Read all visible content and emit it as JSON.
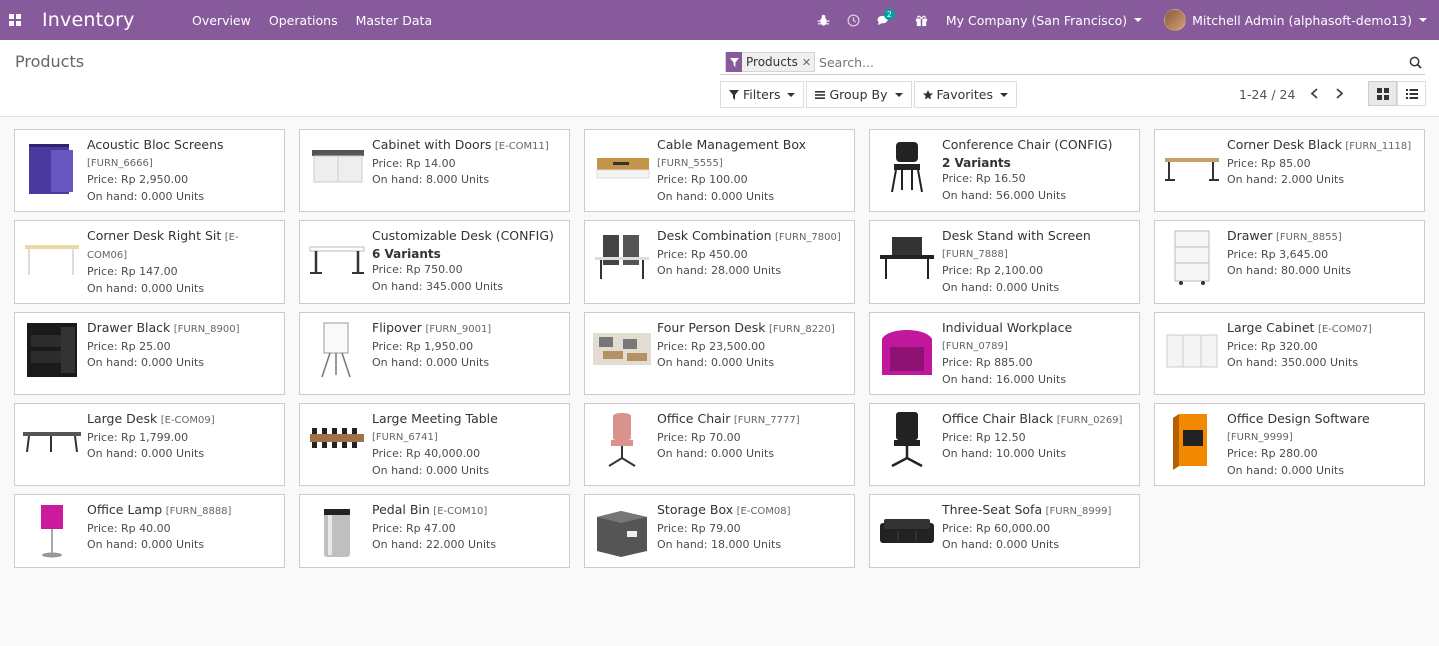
{
  "navbar": {
    "app_title": "Inventory",
    "menu": [
      "Overview",
      "Operations",
      "Master Data"
    ],
    "chat_badge": "2",
    "company": "My Company (San Francisco)",
    "user": "Mitchell Admin (alphasoft-demo13)",
    "color": "#875a9b"
  },
  "control": {
    "title": "Products",
    "facet": "Products",
    "search_placeholder": "Search...",
    "filters_label": "Filters",
    "groupby_label": "Group By",
    "favorites_label": "Favorites",
    "pager": "1-24 / 24"
  },
  "products": [
    {
      "name": "Acoustic Bloc Screens",
      "code": "[FURN_6666]",
      "price": "Price: Rp 2,950.00",
      "onhand": "On hand: 0.000 Units",
      "variants": "",
      "icon": "acoustic-screen-image"
    },
    {
      "name": "Cabinet with Doors",
      "code": "[E-COM11]",
      "price": "Price: Rp 14.00",
      "onhand": "On hand: 8.000 Units",
      "variants": "",
      "icon": "cabinet-image"
    },
    {
      "name": "Cable Management Box",
      "code": "[FURN_5555]",
      "price": "Price: Rp 100.00",
      "onhand": "On hand: 0.000 Units",
      "variants": "",
      "icon": "cable-box-image"
    },
    {
      "name": "Conference Chair (CONFIG)",
      "code": "",
      "price": "Price: Rp 16.50",
      "onhand": "On hand: 56.000 Units",
      "variants": "2 Variants",
      "icon": "conference-chair-image"
    },
    {
      "name": "Corner Desk Black",
      "code": "[FURN_1118]",
      "price": "Price: Rp 85.00",
      "onhand": "On hand: 2.000 Units",
      "variants": "",
      "icon": "corner-desk-image"
    },
    {
      "name": "Corner Desk Right Sit",
      "code": "[E-COM06]",
      "price": "Price: Rp 147.00",
      "onhand": "On hand: 0.000 Units",
      "variants": "",
      "icon": "corner-desk-right-image"
    },
    {
      "name": "Customizable Desk (CONFIG)",
      "code": "",
      "price": "Price: Rp 750.00",
      "onhand": "On hand: 345.000 Units",
      "variants": "6 Variants",
      "icon": "desk-image"
    },
    {
      "name": "Desk Combination",
      "code": "[FURN_7800]",
      "price": "Price: Rp 450.00",
      "onhand": "On hand: 28.000 Units",
      "variants": "",
      "icon": "desk-combination-image"
    },
    {
      "name": "Desk Stand with Screen",
      "code": "[FURN_7888]",
      "price": "Price: Rp 2,100.00",
      "onhand": "On hand: 0.000 Units",
      "variants": "",
      "icon": "desk-stand-image"
    },
    {
      "name": "Drawer",
      "code": "[FURN_8855]",
      "price": "Price: Rp 3,645.00",
      "onhand": "On hand: 80.000 Units",
      "variants": "",
      "icon": "drawer-image"
    },
    {
      "name": "Drawer Black",
      "code": "[FURN_8900]",
      "price": "Price: Rp 25.00",
      "onhand": "On hand: 0.000 Units",
      "variants": "",
      "icon": "drawer-black-image"
    },
    {
      "name": "Flipover",
      "code": "[FURN_9001]",
      "price": "Price: Rp 1,950.00",
      "onhand": "On hand: 0.000 Units",
      "variants": "",
      "icon": "flipover-image"
    },
    {
      "name": "Four Person Desk",
      "code": "[FURN_8220]",
      "price": "Price: Rp 23,500.00",
      "onhand": "On hand: 0.000 Units",
      "variants": "",
      "icon": "four-person-desk-image"
    },
    {
      "name": "Individual Workplace",
      "code": "[FURN_0789]",
      "price": "Price: Rp 885.00",
      "onhand": "On hand: 16.000 Units",
      "variants": "",
      "icon": "workplace-image"
    },
    {
      "name": "Large Cabinet",
      "code": "[E-COM07]",
      "price": "Price: Rp 320.00",
      "onhand": "On hand: 350.000 Units",
      "variants": "",
      "icon": "large-cabinet-image"
    },
    {
      "name": "Large Desk",
      "code": "[E-COM09]",
      "price": "Price: Rp 1,799.00",
      "onhand": "On hand: 0.000 Units",
      "variants": "",
      "icon": "large-desk-image"
    },
    {
      "name": "Large Meeting Table",
      "code": "[FURN_6741]",
      "price": "Price: Rp 40,000.00",
      "onhand": "On hand: 0.000 Units",
      "variants": "",
      "icon": "meeting-table-image"
    },
    {
      "name": "Office Chair",
      "code": "[FURN_7777]",
      "price": "Price: Rp 70.00",
      "onhand": "On hand: 0.000 Units",
      "variants": "",
      "icon": "office-chair-image"
    },
    {
      "name": "Office Chair Black",
      "code": "[FURN_0269]",
      "price": "Price: Rp 12.50",
      "onhand": "On hand: 10.000 Units",
      "variants": "",
      "icon": "office-chair-black-image"
    },
    {
      "name": "Office Design Software",
      "code": "[FURN_9999]",
      "price": "Price: Rp 280.00",
      "onhand": "On hand: 0.000 Units",
      "variants": "",
      "icon": "software-box-image"
    },
    {
      "name": "Office Lamp",
      "code": "[FURN_8888]",
      "price": "Price: Rp 40.00",
      "onhand": "On hand: 0.000 Units",
      "variants": "",
      "icon": "lamp-image"
    },
    {
      "name": "Pedal Bin",
      "code": "[E-COM10]",
      "price": "Price: Rp 47.00",
      "onhand": "On hand: 22.000 Units",
      "variants": "",
      "icon": "pedal-bin-image"
    },
    {
      "name": "Storage Box",
      "code": "[E-COM08]",
      "price": "Price: Rp 79.00",
      "onhand": "On hand: 18.000 Units",
      "variants": "",
      "icon": "storage-box-image"
    },
    {
      "name": "Three-Seat Sofa",
      "code": "[FURN_8999]",
      "price": "Price: Rp 60,000.00",
      "onhand": "On hand: 0.000 Units",
      "variants": "",
      "icon": "sofa-image"
    }
  ]
}
